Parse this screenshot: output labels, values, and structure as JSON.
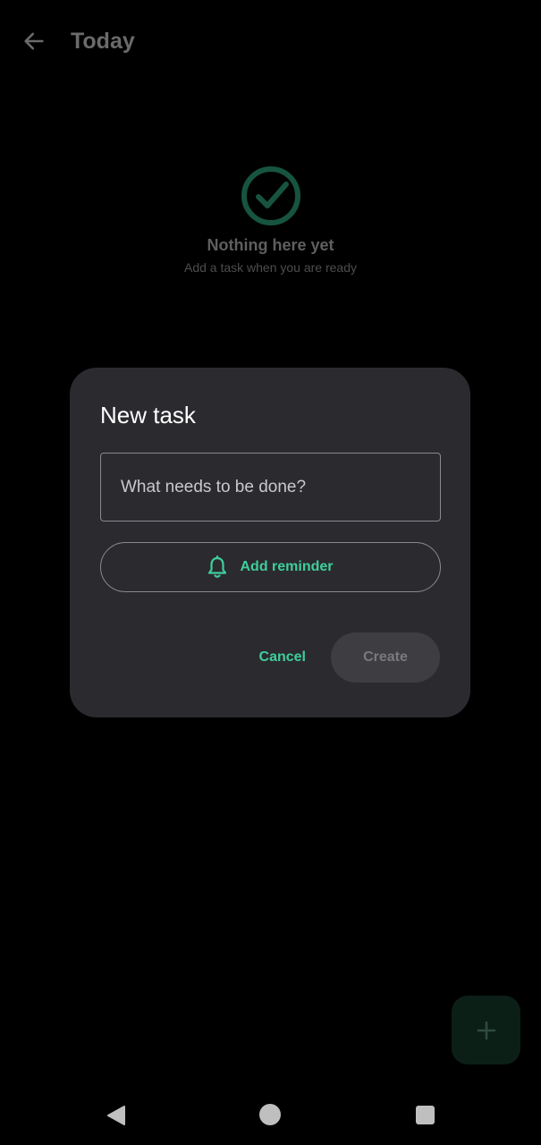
{
  "topbar": {
    "title": "Today"
  },
  "empty_state": {
    "title": "Nothing here yet",
    "subtitle": "Add a task when you are ready"
  },
  "dialog": {
    "title": "New task",
    "input_placeholder": "What needs to be done?",
    "input_value": "",
    "reminder_label": "Add reminder",
    "cancel_label": "Cancel",
    "create_label": "Create"
  },
  "colors": {
    "accent": "#3ecf9a",
    "dialog_bg": "#2b2a2f",
    "fab_bg": "#0b1f17"
  },
  "icons": {
    "back": "arrow-left-icon",
    "empty": "check-circle-icon",
    "reminder": "bell-icon",
    "fab": "plus-icon",
    "nav_back": "triangle-back-icon",
    "nav_home": "circle-home-icon",
    "nav_recents": "square-recents-icon"
  }
}
